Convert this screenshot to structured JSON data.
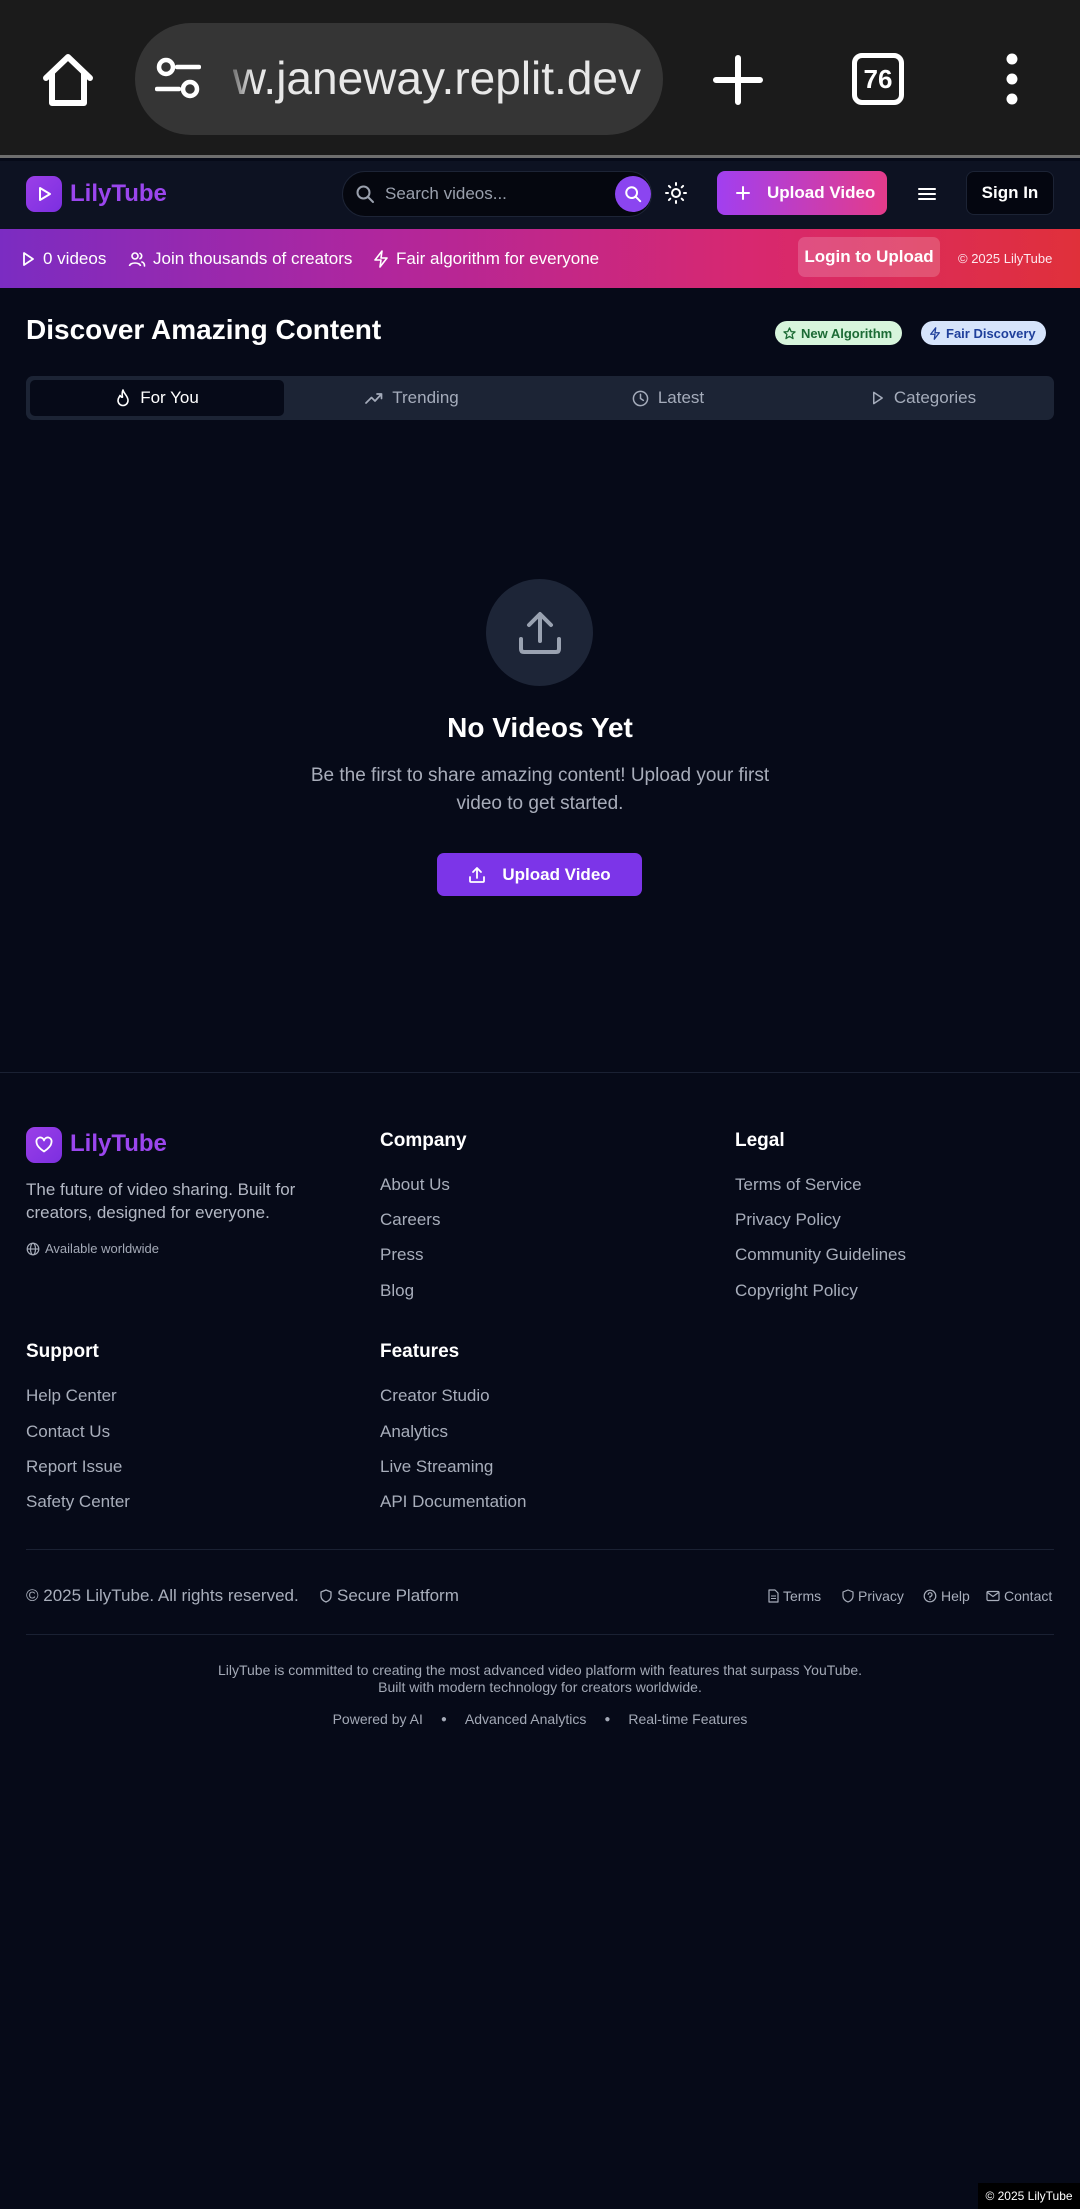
{
  "browser": {
    "url": "preview.janeway.replit.dev",
    "tab_count": "76"
  },
  "header": {
    "brand": "LilyTube",
    "search_placeholder": "Search videos...",
    "upload_label": "Upload Video",
    "signin_label": "Sign In"
  },
  "banner": {
    "videos": "0 videos",
    "creators": "Join thousands of creators",
    "algorithm": "Fair algorithm for everyone",
    "login_upload": "Login to Upload",
    "copyright": "© 2025 LilyTube"
  },
  "main": {
    "title": "Discover Amazing Content",
    "badges": [
      "New Algorithm",
      "Fair Discovery"
    ],
    "tabs": [
      "For You",
      "Trending",
      "Latest",
      "Categories"
    ],
    "active_tab": "For You",
    "empty": {
      "title": "No Videos Yet",
      "description": "Be the first to share amazing content! Upload your first video to get started.",
      "button": "Upload Video"
    }
  },
  "footer": {
    "brand": "LilyTube",
    "tagline": "The future of video sharing. Built for creators, designed for everyone.",
    "worldwide": "Available worldwide",
    "company": {
      "title": "Company",
      "links": [
        "About Us",
        "Careers",
        "Press",
        "Blog"
      ]
    },
    "legal": {
      "title": "Legal",
      "links": [
        "Terms of Service",
        "Privacy Policy",
        "Community Guidelines",
        "Copyright Policy"
      ]
    },
    "support": {
      "title": "Support",
      "links": [
        "Help Center",
        "Contact Us",
        "Report Issue",
        "Safety Center"
      ]
    },
    "features": {
      "title": "Features",
      "links": [
        "Creator Studio",
        "Analytics",
        "Live Streaming",
        "API Documentation"
      ]
    },
    "copyright": "© 2025 LilyTube. All rights reserved.",
    "secure": "Secure Platform",
    "bottom_links": [
      "Terms",
      "Privacy",
      "Help",
      "Contact"
    ],
    "mission_line1": "LilyTube is committed to creating the most advanced video platform with features that surpass YouTube.",
    "mission_line2": "Built with modern technology for creators worldwide.",
    "feature_tags": [
      "Powered by AI",
      "Advanced Analytics",
      "Real-time Features"
    ],
    "corner_tag": "© 2025 LilyTube"
  },
  "colors": {
    "accent": "#8b45f0",
    "brand_text": "#9b46ee",
    "banner_start": "#7b2cc2",
    "banner_end": "#e0303a",
    "background": "#060a18"
  }
}
